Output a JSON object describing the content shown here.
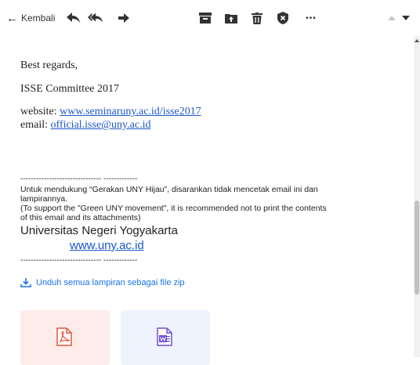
{
  "toolbar": {
    "back_label": "Kembali",
    "icons": [
      "reply-icon",
      "reply-all-icon",
      "forward-icon",
      "archive-icon",
      "move-icon",
      "delete-icon",
      "spam-icon",
      "more-icon",
      "prev-icon",
      "next-icon"
    ],
    "more_glyph": "•••"
  },
  "email": {
    "closing": "Best regards,",
    "committee": "ISSE Committee 2017",
    "website_label": "website: ",
    "website_link": "www.seminaruny.ac.id/isse2017",
    "email_label": "email: ",
    "email_link": "official.isse@uny.ac.id",
    "separator": "------------------------------- -------------",
    "notice_id_line1": "Untuk mendukung “Gerakan UNY Hijau”, disarankan tidak mencetak email ini dan",
    "notice_id_line2": "lampirannya.",
    "notice_en_line1": "(To support the \"Green UNY movement\", it is recommended not to print the contents",
    "notice_en_line2": "of this email and its attachments)",
    "university": "Universitas Negeri Yogyakarta",
    "university_link": "www.uny.ac.id",
    "separator2": "------------------------------- -------------"
  },
  "attachments": {
    "download_all_label": "Unduh semua lampiran sebagai file zip",
    "items": [
      {
        "type": "pdf",
        "icon": "pdf-file-icon",
        "color": "#e8543b"
      },
      {
        "type": "doc",
        "icon": "word-file-icon",
        "color": "#6c4fd6"
      }
    ]
  },
  "colors": {
    "link": "#1a56c9",
    "accent": "#1a73e8"
  }
}
